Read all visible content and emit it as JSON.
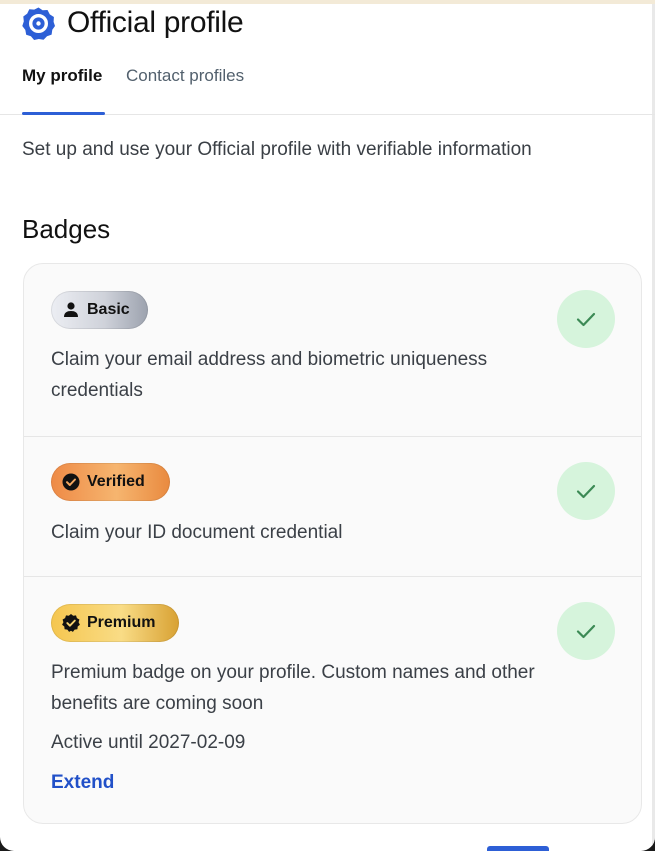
{
  "header": {
    "title": "Official profile",
    "logo_icon": "official-logo-icon",
    "brand_color": "#2d5fd6"
  },
  "tabs": [
    {
      "label": "My profile",
      "active": true
    },
    {
      "label": "Contact profiles",
      "active": false
    }
  ],
  "description": "Set up and use your Official profile with verifiable information",
  "badges_section": {
    "title": "Badges",
    "items": [
      {
        "badge_label": "Basic",
        "badge_icon": "person-icon",
        "description": "Claim your email address and biometric uniqueness credentials",
        "status_icon": "check-icon",
        "completed": true
      },
      {
        "badge_label": "Verified",
        "badge_icon": "verified-check-icon",
        "description": "Claim your ID document credential",
        "status_icon": "check-icon",
        "completed": true
      },
      {
        "badge_label": "Premium",
        "badge_icon": "premium-seal-icon",
        "description": "Premium badge on your profile. Custom names and other benefits are coming soon",
        "active_until": "Active until 2027-02-09",
        "extend_label": "Extend",
        "status_icon": "check-icon",
        "completed": true
      }
    ]
  },
  "colors": {
    "check_bg": "#d6f4dc",
    "check_stroke": "#3c8a55",
    "link": "#2150c8"
  }
}
